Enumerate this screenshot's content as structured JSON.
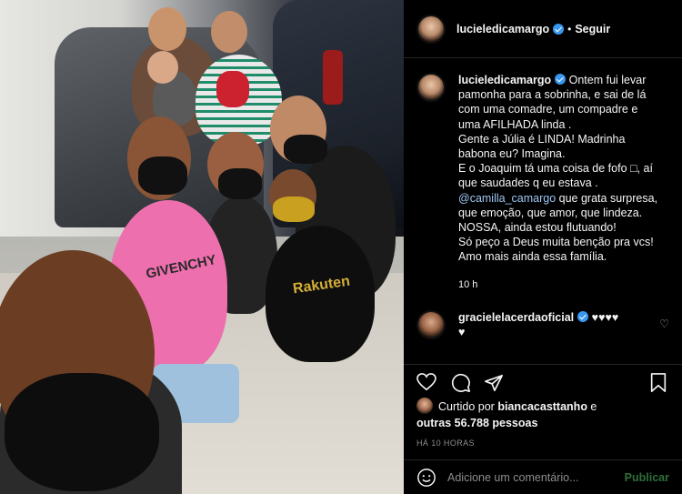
{
  "photo": {
    "alt_subject": "family selfie photo",
    "jersey_text": "Rakuten",
    "shirt_text": "GIVENCHY"
  },
  "header": {
    "username": "lucieledicamargo",
    "separator": "•",
    "follow_label": "Seguir"
  },
  "caption": {
    "username": "lucieledicamargo",
    "text_lines": [
      "Ontem fui levar",
      "pamonha para a sobrinha, e sai de lá",
      "com uma comadre, um compadre e",
      "uma AFILHADA linda .",
      "Gente a Júlia é LINDA! Madrinha",
      "babona eu? Imagina.",
      "E o Joaquim tá uma coisa de fofo □, aí",
      "que saudades q eu estava ."
    ],
    "mention": "@camilla_camargo",
    "after_mention": " que grata surpresa,",
    "text_lines_2": [
      "que emoção, que amor, que lindeza.",
      "NOSSA, ainda estou flutuando!",
      "Só peço a Deus muita benção pra vcs!",
      "Amo mais ainda essa família."
    ],
    "time": "10 h"
  },
  "comment": {
    "username": "gracielelacerdaoficial",
    "text_line1": "♥♥♥♥",
    "text_line2": "♥"
  },
  "likes": {
    "prefix": "Curtido por ",
    "user": "biancacasttanho",
    "conj": " e",
    "others": "outras 56.788 pessoas"
  },
  "timestamp": "HÁ 10 HORAS",
  "add_comment": {
    "placeholder": "Adicione um comentário...",
    "publish_label": "Publicar"
  },
  "colors": {
    "verified": "#3897f0",
    "mention": "#9fc7f5",
    "publish": "#2f6f3b",
    "divider": "#262626"
  }
}
